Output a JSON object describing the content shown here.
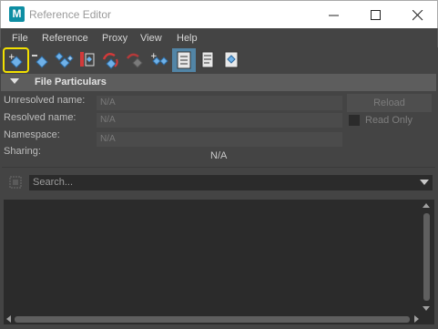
{
  "window": {
    "logo_letter": "M",
    "title": "Reference Editor"
  },
  "menu": [
    "File",
    "Reference",
    "Proxy",
    "View",
    "Help"
  ],
  "toolbar": {
    "tools": [
      "create-reference-icon",
      "remove-reference-icon",
      "import-reference-icon",
      "load-reference-icon",
      "reload-reference-icon",
      "unload-reference-icon",
      "duplicate-reference-icon",
      "list-view-icon",
      "list-edits-icon",
      "file-info-icon"
    ],
    "highlighted_tool": "create-reference-icon",
    "highlight_color": "#f2e000",
    "active_color": "#5285a6"
  },
  "particulars": {
    "title": "File Particulars",
    "unresolved_label": "Unresolved name:",
    "unresolved_value": "N/A",
    "resolved_label": "Resolved name:",
    "resolved_value": "N/A",
    "namespace_label": "Namespace:",
    "namespace_value": "N/A",
    "sharing_label": "Sharing:",
    "sharing_value": "N/A",
    "reload_label": "Reload",
    "readonly_label": "Read Only",
    "readonly_checked": false
  },
  "search": {
    "placeholder": "Search..."
  }
}
